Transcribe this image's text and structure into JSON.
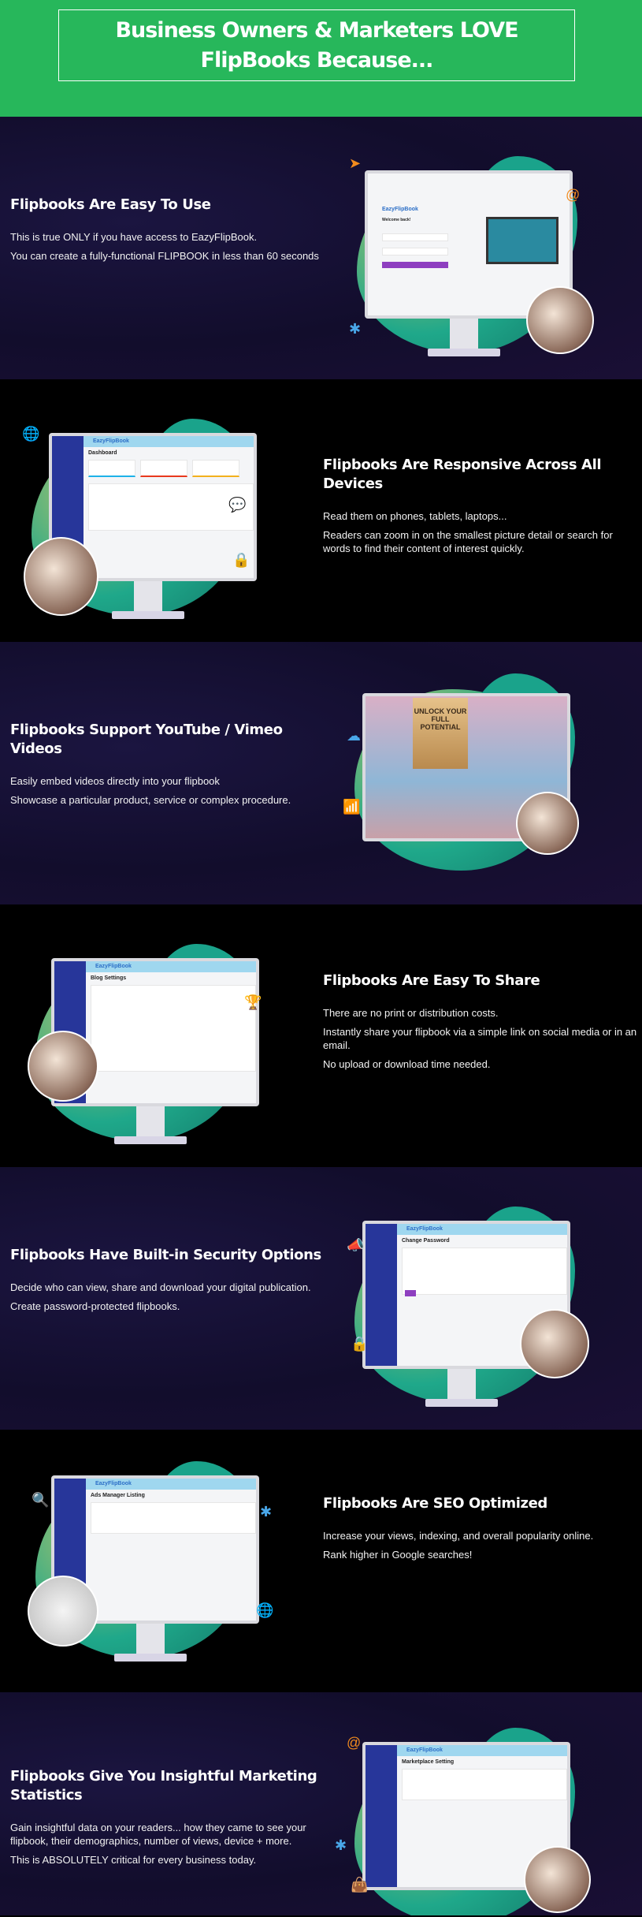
{
  "header": {
    "title_line1": "Business Owners & Marketers LOVE",
    "title_line2": "FlipBooks Because..."
  },
  "colors": {
    "brand_green": "#27b75b",
    "dark_bg": "#120d2c",
    "teal": "#1aa38b",
    "purple_button": "#8e3fc0",
    "orange_icon": "#f28b1d"
  },
  "sections": [
    {
      "heading": "Flipbooks Are Easy To Use",
      "paragraphs": [
        "This is true ONLY if you have access to EazyFlipBook.",
        "You can create a fully-functional FLIPBOOK in less than 60 seconds"
      ],
      "screen": {
        "logo": "EazyFlipBook",
        "title": "Welcome back!"
      }
    },
    {
      "heading": "Flipbooks Are Responsive Across All Devices",
      "paragraphs": [
        "Read them on phones, tablets, laptops...",
        "Readers can zoom in on the smallest picture detail or search for words to find their content of interest quickly."
      ],
      "screen": {
        "logo": "EazyFlipBook",
        "title": "Dashboard"
      }
    },
    {
      "heading": "Flipbooks Support YouTube / Vimeo Videos",
      "paragraphs": [
        "Easily embed videos directly into your flipbook",
        "Showcase a particular product, service or complex procedure."
      ],
      "screen": {
        "title": "UNLOCK YOUR FULL POTENTIAL"
      }
    },
    {
      "heading": "Flipbooks Are Easy To Share",
      "paragraphs": [
        "There are no print or distribution costs.",
        " Instantly share your flipbook via a simple link on social media or in an email.",
        "No upload or download time needed."
      ],
      "screen": {
        "logo": "EazyFlipBook",
        "title": "Blog Settings"
      }
    },
    {
      "heading": "Flipbooks Have Built-in Security Options",
      "paragraphs": [
        "Decide who can view, share and download your digital publication.",
        "Create password-protected flipbooks."
      ],
      "screen": {
        "logo": "EazyFlipBook",
        "title": "Change Password"
      }
    },
    {
      "heading": "Flipbooks Are SEO Optimized",
      "paragraphs": [
        "Increase your views, indexing, and overall popularity online.",
        "Rank higher in Google searches!"
      ],
      "screen": {
        "logo": "EazyFlipBook",
        "title": "Ads Manager Listing"
      }
    },
    {
      "heading": "Flipbooks Give You Insightful Marketing Statistics",
      "paragraphs": [
        "Gain insightful data on your readers... how they came to see your flipbook, their demographics, number of views, device + more.",
        "This is ABSOLUTELY critical for every business today."
      ],
      "screen": {
        "logo": "EazyFlipBook",
        "title": "Marketplace Setting"
      }
    }
  ]
}
